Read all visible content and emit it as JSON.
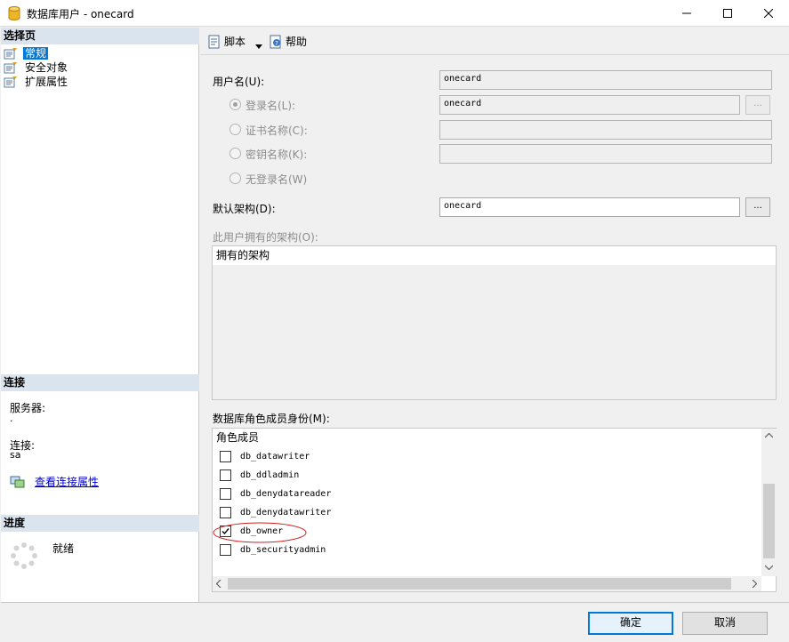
{
  "window": {
    "title": "数据库用户 - onecard"
  },
  "left": {
    "select_page_title": "选择页",
    "pages": [
      {
        "label": "常规",
        "selected": true
      },
      {
        "label": "安全对象",
        "selected": false
      },
      {
        "label": "扩展属性",
        "selected": false
      }
    ],
    "connection_title": "连接",
    "server_label": "服务器:",
    "server_value": ".",
    "connection_label": "连接:",
    "connection_value": "sa",
    "view_conn_props": "查看连接属性",
    "progress_title": "进度",
    "progress_status": "就绪"
  },
  "toolbar": {
    "script_label": "脚本",
    "help_label": "帮助"
  },
  "form": {
    "username_label": "用户名(U):",
    "username_value": "onecard",
    "login_name_label": "登录名(L):",
    "login_name_value": "onecard",
    "cert_name_label": "证书名称(C):",
    "cert_name_value": "",
    "key_name_label": "密钥名称(K):",
    "key_name_value": "",
    "no_login_label": "无登录名(W)",
    "default_schema_label": "默认架构(D):",
    "default_schema_value": "onecard",
    "dots": "...",
    "owned_schemas_label": "此用户拥有的架构(O):",
    "owned_schemas_header": "拥有的架构",
    "role_membership_label": "数据库角色成员身份(M):",
    "role_members_header": "角色成员",
    "roles": [
      {
        "name": "db_datawriter",
        "checked": false
      },
      {
        "name": "db_ddladmin",
        "checked": false
      },
      {
        "name": "db_denydatareader",
        "checked": false
      },
      {
        "name": "db_denydatawriter",
        "checked": false
      },
      {
        "name": "db_owner",
        "checked": true
      },
      {
        "name": "db_securityadmin",
        "checked": false
      }
    ]
  },
  "buttons": {
    "ok": "确定",
    "cancel": "取消"
  }
}
